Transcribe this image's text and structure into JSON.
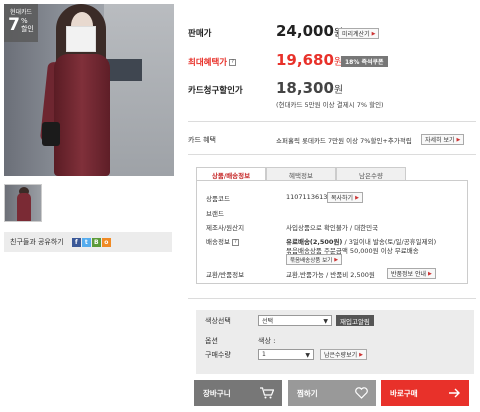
{
  "product": {
    "card_badge_title": "현대카드",
    "card_badge_num": "7",
    "card_badge_pct": "%",
    "card_badge_sub": "할인"
  },
  "share": {
    "label": "친구들과 공유하기",
    "icons": [
      "facebook-icon",
      "twitter-icon",
      "blog-icon",
      "rss-icon"
    ],
    "icon_glyphs": [
      "f",
      "t",
      "B",
      "o"
    ],
    "icon_colors": [
      "#3b5998",
      "#55acee",
      "#5c9b3a",
      "#f08a24"
    ]
  },
  "pricing": {
    "sale_label": "판매가",
    "sale_price": "24,000",
    "won": "원",
    "preview_btn": "미리계산기",
    "max_benefit_label": "최대혜택가",
    "max_benefit_price": "19,680",
    "immediate_badge": "18% 즉석쿠폰",
    "card_label": "카드청구할인가",
    "card_price": "18,300",
    "card_note": "(현대카드 5만원 이상 결제시 7% 할인)",
    "card_benefit_label": "카드 혜택",
    "card_benefit_text": "쇼퍼홀릭 롯데카드 7만원 이상 7%할인+추가적립",
    "detail_btn": "자세히 보기"
  },
  "tabs": [
    {
      "label": "상품/배송정보",
      "active": true
    },
    {
      "label": "혜택정보",
      "active": false
    },
    {
      "label": "남은수량",
      "active": false
    }
  ],
  "info": {
    "code_label": "상품코드",
    "code_value": "1107113613",
    "copy_btn": "복사하기",
    "brand_label": "브랜드",
    "origin_label": "제조사/원산지",
    "origin_value": "사입상품으로 확인불가 / 대한민국",
    "shipping_label": "배송정보",
    "shipping_line1": "유료배송(2,500원)",
    "shipping_line1b": " / 3일이내 발송(토/일/공휴일제외)",
    "shipping_line2": "묶음배송상품 주문금액 50,000원 이상 무료배송",
    "shipping_btn": "묶음배송상품 보기",
    "return_label": "교환/반품정보",
    "return_value": "교환,반품가능 / 반품비 2,500원",
    "return_btn": "반품정보 안내"
  },
  "options": {
    "color_label": "색상선택",
    "color_value": "선택",
    "restock_btn": "재입고알림",
    "option_label": "옵션",
    "option_value": "색상 :",
    "qty_label": "구매수량",
    "qty_value": "1",
    "remain_btn": "남은수량보기"
  },
  "actions": {
    "cart": "장바구니",
    "wish": "찜하기",
    "buy": "바로구매",
    "cart_color": "#777777",
    "wish_color": "#999999",
    "buy_color": "#e8312a"
  }
}
